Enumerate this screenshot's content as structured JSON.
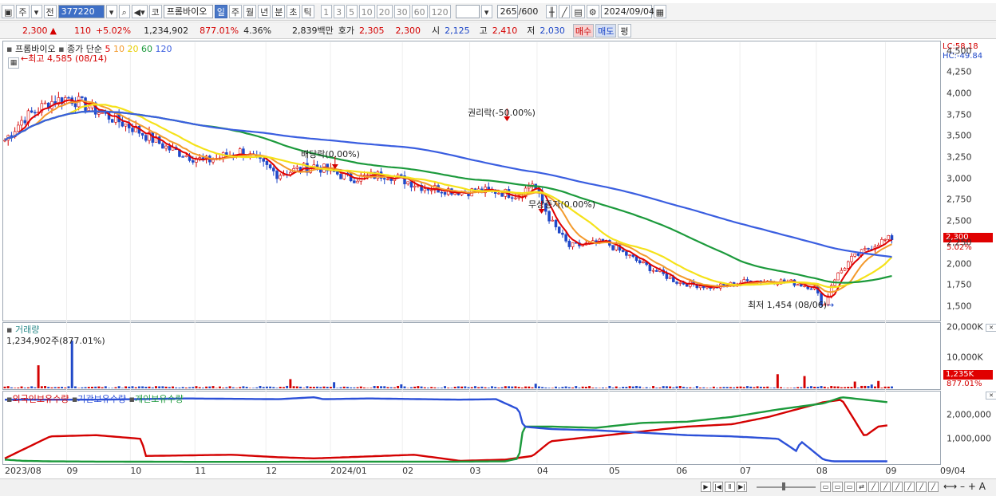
{
  "toolbar": {
    "market": "주",
    "prev": "전",
    "code": "377220",
    "stock_name": "프롬바이오",
    "periods": [
      "일",
      "주",
      "월",
      "년",
      "분",
      "초",
      "틱"
    ],
    "active_period": "일",
    "nums": [
      "1",
      "3",
      "5",
      "10",
      "20",
      "30",
      "60",
      "120"
    ],
    "count": "265",
    "count_max": "/600",
    "date": "2024/09/04"
  },
  "quote": {
    "price": "2,300",
    "change_arrow": "▲",
    "change": "110",
    "rate": "+5.02%",
    "volume": "1,234,902",
    "volume_rate": "877.01%",
    "turnover": "4.36%",
    "amount": "2,839백만",
    "ask_label": "호가",
    "ask": "2,305",
    "bid": "2,300",
    "open_label": "시",
    "open": "2,125",
    "high_label": "고",
    "high": "2,410",
    "low_label": "저",
    "low": "2,030",
    "buy": "매수",
    "sell": "매도",
    "avg": "평"
  },
  "price_panel": {
    "legend_name": "프롬바이오",
    "legend_ma": "종가 단순",
    "ma_labels": [
      "5",
      "10",
      "20",
      "60",
      "120"
    ],
    "lc": "LC:58.18",
    "hc": "HC:-49.84",
    "high_note": "최고 4,585 (08/14)",
    "low_note": "최저 1,454 (08/06)",
    "ann_rights": "권리락(-50.00%)",
    "ann_div": "배당락(0.00%)",
    "ann_bonus": "무상증자(0.00%)",
    "price_tag": "2,300",
    "rate_tag": "5.02%"
  },
  "volume_panel": {
    "title": "거래량",
    "value": "1,234,902주(877.01%)",
    "vol_tag": "1,235K",
    "rate_tag": "877.01%"
  },
  "holding_panel": {
    "foreign": "외국인보유수량",
    "inst": "기관보유수량",
    "indiv": "개인보유수량"
  },
  "x_labels": [
    {
      "t": "2023/08",
      "p": 0.0
    },
    {
      "t": "09",
      "p": 0.068
    },
    {
      "t": "10",
      "p": 0.138
    },
    {
      "t": "11",
      "p": 0.209
    },
    {
      "t": "12",
      "p": 0.287
    },
    {
      "t": "2024/01",
      "p": 0.358
    },
    {
      "t": "02",
      "p": 0.437
    },
    {
      "t": "03",
      "p": 0.511
    },
    {
      "t": "04",
      "p": 0.585
    },
    {
      "t": "05",
      "p": 0.664
    },
    {
      "t": "06",
      "p": 0.738
    },
    {
      "t": "07",
      "p": 0.808
    },
    {
      "t": "08",
      "p": 0.892
    },
    {
      "t": "09",
      "p": 0.968
    },
    {
      "t": "09/04",
      "p": 1.01
    }
  ],
  "chart_data": [
    {
      "type": "candlestick",
      "title": "",
      "ylim": [
        1340,
        4600
      ],
      "y_ticks": [
        1500,
        1750,
        2000,
        2250,
        2500,
        2750,
        3000,
        3250,
        3500,
        3750,
        4000,
        4250,
        4500
      ],
      "y_tick_labels": [
        "1,500",
        "1,750",
        "2,000",
        "2,250",
        "2,500",
        "2,750",
        "3,000",
        "3,250",
        "3,500",
        "3,750",
        "4,000",
        "4,250",
        "4,500"
      ],
      "anchors": {
        "x": [
          0,
          0.02,
          0.05,
          0.07,
          0.1,
          0.14,
          0.18,
          0.22,
          0.26,
          0.3,
          0.34,
          0.38,
          0.42,
          0.46,
          0.5,
          0.54,
          0.565,
          0.58,
          0.6,
          0.62,
          0.66,
          0.7,
          0.74,
          0.78,
          0.82,
          0.86,
          0.89,
          0.9,
          0.91,
          0.93,
          0.96,
          0.975
        ],
        "close": [
          3450,
          3700,
          3900,
          3950,
          3800,
          3600,
          3350,
          3200,
          3320,
          3050,
          3150,
          3000,
          3050,
          2900,
          2850,
          2850,
          2800,
          2950,
          2500,
          2200,
          2250,
          2000,
          1780,
          1720,
          1800,
          1790,
          1720,
          1480,
          1800,
          2050,
          2250,
          2300
        ]
      },
      "series": [
        {
          "name": "5",
          "color": "#e00000"
        },
        {
          "name": "10",
          "color": "#f39a2c"
        },
        {
          "name": "20",
          "color": "#f5e21a"
        },
        {
          "name": "60",
          "color": "#1c9a3c"
        },
        {
          "name": "120",
          "color": "#3a5ee0"
        }
      ]
    },
    {
      "type": "bar",
      "title": "거래량",
      "ylim": [
        0,
        21000000
      ],
      "y_ticks": [
        10000000,
        20000000
      ],
      "y_tick_labels": [
        "10,000K",
        "20,000K"
      ]
    },
    {
      "type": "line",
      "title": "",
      "ylim": [
        0,
        2900000
      ],
      "y_ticks": [
        1000000,
        2000000
      ],
      "y_tick_labels": [
        "1,000,000",
        "2,000,000"
      ],
      "series": [
        {
          "name": "외국인보유수량",
          "color": "#d40000",
          "x": [
            0,
            0.05,
            0.1,
            0.15,
            0.155,
            0.25,
            0.3,
            0.34,
            0.45,
            0.5,
            0.55,
            0.58,
            0.6,
            0.65,
            0.7,
            0.75,
            0.8,
            0.84,
            0.88,
            0.9,
            0.92,
            0.945,
            0.96,
            0.97
          ],
          "y": [
            200000,
            1100000,
            1150000,
            1000000,
            300000,
            350000,
            250000,
            200000,
            350000,
            100000,
            150000,
            300000,
            900000,
            1100000,
            1300000,
            1500000,
            1600000,
            1900000,
            2300000,
            2500000,
            2600000,
            1100000,
            1500000,
            1550000
          ]
        },
        {
          "name": "기관보유수량",
          "color": "#1c9a3c",
          "x": [
            0,
            0.02,
            0.05,
            0.1,
            0.2,
            0.3,
            0.4,
            0.5,
            0.55,
            0.565,
            0.57,
            0.6,
            0.65,
            0.7,
            0.75,
            0.8,
            0.85,
            0.9,
            0.92,
            0.97
          ],
          "y": [
            150000,
            100000,
            80000,
            70000,
            60000,
            60000,
            70000,
            70000,
            80000,
            200000,
            1500000,
            1500000,
            1450000,
            1650000,
            1700000,
            1900000,
            2200000,
            2450000,
            2700000,
            2500000
          ]
        },
        {
          "name": "개인보유수량",
          "color": "#2c50d8",
          "x": [
            0,
            0.1,
            0.2,
            0.3,
            0.34,
            0.35,
            0.4,
            0.5,
            0.54,
            0.565,
            0.57,
            0.6,
            0.65,
            0.7,
            0.75,
            0.8,
            0.85,
            0.87,
            0.875,
            0.9,
            0.91,
            0.97
          ],
          "y": [
            2600000,
            2600000,
            2650000,
            2620000,
            2700000,
            2620000,
            2650000,
            2600000,
            2620000,
            2200000,
            1500000,
            1400000,
            1350000,
            1250000,
            1150000,
            1100000,
            1000000,
            500000,
            900000,
            150000,
            80000,
            80000
          ]
        }
      ]
    }
  ]
}
